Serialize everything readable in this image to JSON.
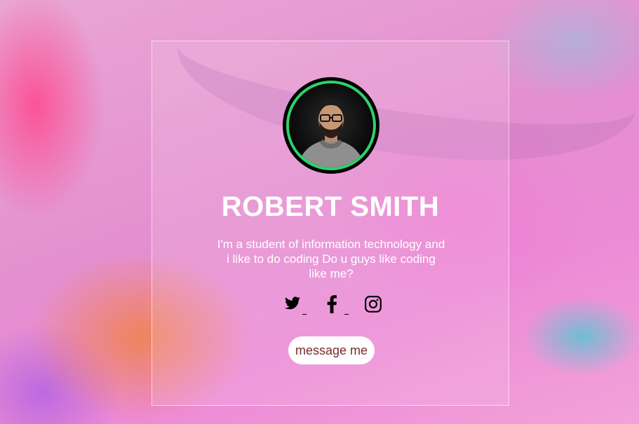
{
  "profile": {
    "name": "ROBERT SMITH",
    "bio": "I'm a student of information technology and i like to do coding Do u guys like coding like me?"
  },
  "socials": [
    {
      "icon": "twitter-icon"
    },
    {
      "icon": "facebook-icon"
    },
    {
      "icon": "instagram-icon"
    }
  ],
  "actions": {
    "message_label": "message me"
  },
  "colors": {
    "avatar_ring": "#2fd06a",
    "button_text": "#7a2a2a",
    "card_text": "#ffffff"
  }
}
